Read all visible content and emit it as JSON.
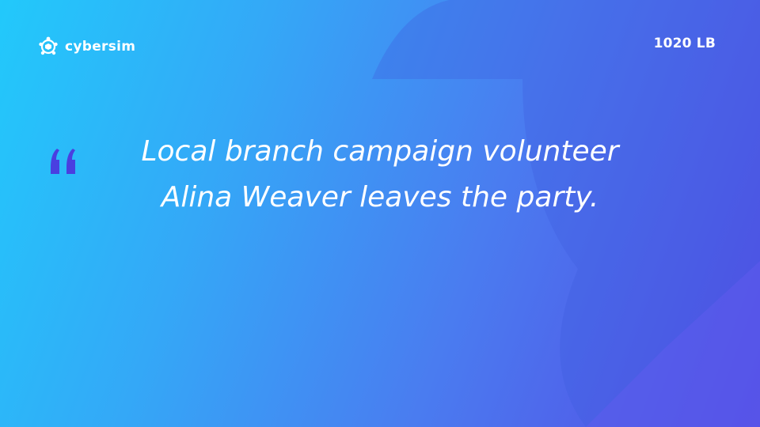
{
  "brand": {
    "name": "cybersim",
    "logo_icon": "turtle-shield-icon"
  },
  "counter": {
    "label": "1020 LB"
  },
  "quote": {
    "icon": "quote-mark-icon",
    "text": "Local branch campaign volunteer Alina Weaver leaves the party."
  },
  "colors": {
    "gradient_start": "#22c9fb",
    "gradient_end": "#5548e4",
    "quote_mark": "#4a3fe0",
    "text": "#ffffff"
  }
}
